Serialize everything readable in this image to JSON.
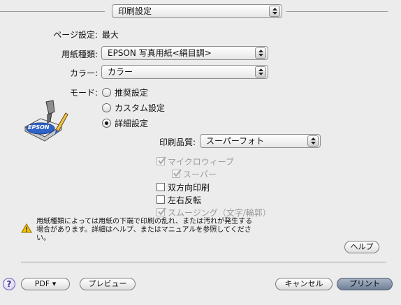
{
  "panel_popup": {
    "value": "印刷設定"
  },
  "preset": {
    "label": "ページ設定:",
    "value": "最大"
  },
  "media_type": {
    "label": "用紙種類:",
    "value": "EPSON 写真用紙<絹目調>"
  },
  "color": {
    "label": "カラー:",
    "value": "カラー"
  },
  "mode": {
    "label": "モード:",
    "options": [
      {
        "label": "推奨設定",
        "selected": false
      },
      {
        "label": "カスタム設定",
        "selected": false
      },
      {
        "label": "詳細設定",
        "selected": true
      }
    ]
  },
  "print_quality": {
    "label": "印刷品質:",
    "value": "スーパーフォト"
  },
  "checkboxes": {
    "microweave": {
      "label": "マイクロウィーブ",
      "checked": true,
      "enabled": false
    },
    "super": {
      "label": "スーパー",
      "checked": true,
      "enabled": false
    },
    "bidirectional": {
      "label": "双方向印刷",
      "checked": false,
      "enabled": true
    },
    "flip_horizontal": {
      "label": "左右反転",
      "checked": false,
      "enabled": true
    },
    "smoothing": {
      "label": "スムージング（文字/輪郭）",
      "checked": true,
      "enabled": false
    }
  },
  "warning": {
    "line1": "用紙種類によっては用紙の下端で印刷の乱れ、または汚れが発生する",
    "line2": "場合があります。詳細はヘルプ、またはマニュアルを参照してくださ",
    "line3": "い。"
  },
  "buttons": {
    "help": "ヘルプ",
    "help_circle": "?",
    "pdf": "PDF ▾",
    "preview": "プレビュー",
    "cancel": "キャンセル",
    "print": "プリント"
  },
  "logo_text": "EPSON",
  "colors": {
    "accent": "#6f7f96",
    "background": "#ececec",
    "warning": "#f2c200"
  }
}
